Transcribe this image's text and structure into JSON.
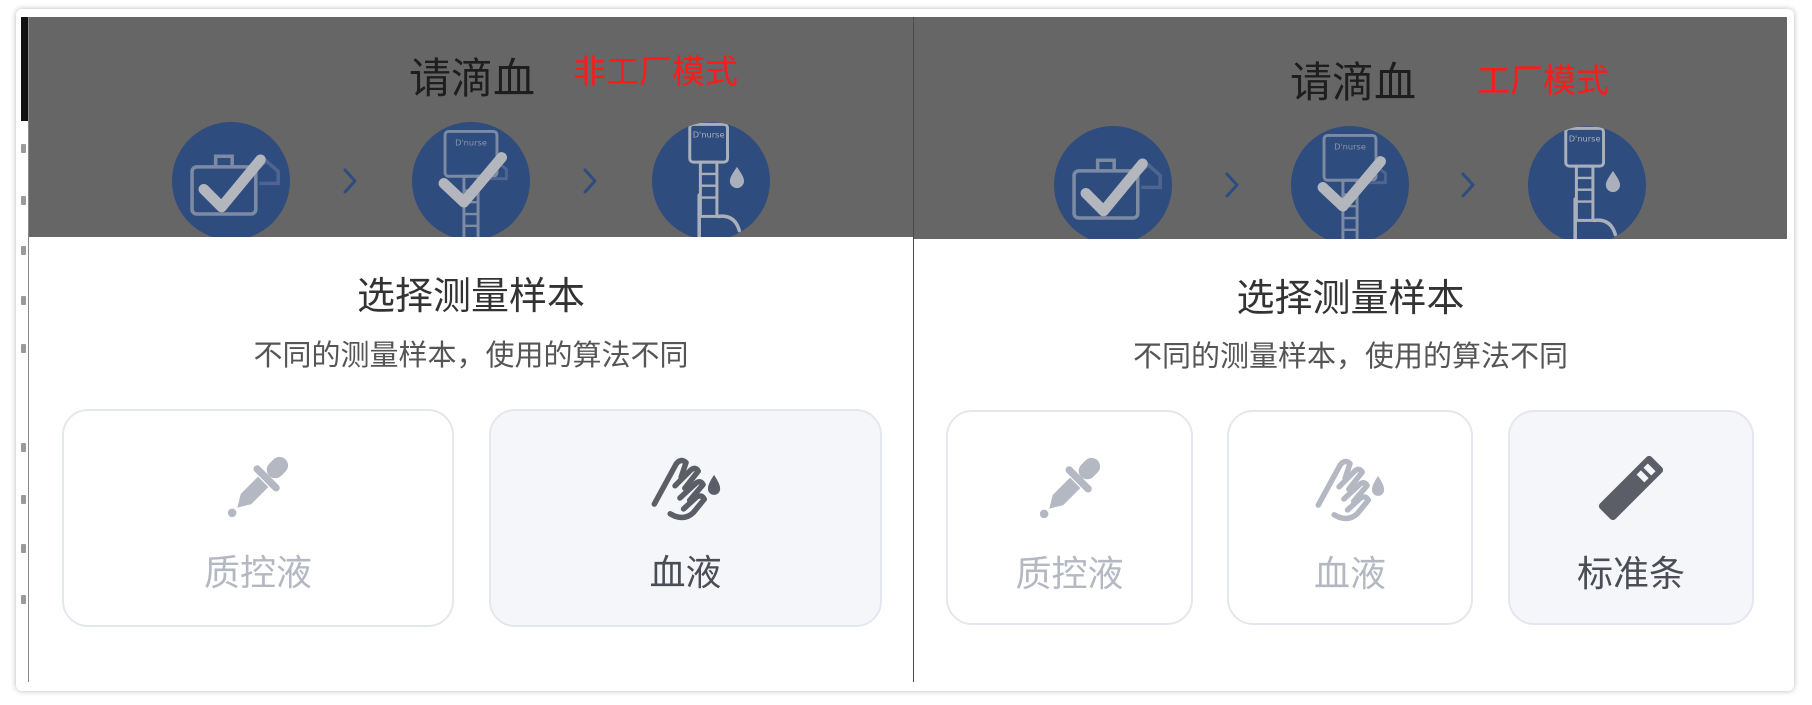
{
  "colors": {
    "header_dim": "#666666",
    "step_circle": "#2f4c7f",
    "mode_label": "#ff1a1a",
    "card_selected_bg": "#f5f6fa",
    "inactive": "#b4b8c3",
    "active": "#4a4d55"
  },
  "panels": [
    {
      "header": {
        "title": "请滴血",
        "mode_label": "非工厂模式",
        "device_logo": "D'nurse",
        "steps": [
          {
            "icon": "kit-check-icon"
          },
          {
            "icon": "device-check-icon"
          },
          {
            "icon": "finger-blood-icon"
          }
        ]
      },
      "sheet": {
        "title": "选择测量样本",
        "subtitle": "不同的测量样本，使用的算法不同",
        "options": [
          {
            "label": "质控液",
            "icon": "dropper-icon",
            "selected": false
          },
          {
            "label": "血液",
            "icon": "blood-hand-icon",
            "selected": true
          }
        ]
      }
    },
    {
      "header": {
        "title": "请滴血",
        "mode_label": "工厂模式",
        "device_logo": "D'nurse",
        "steps": [
          {
            "icon": "kit-check-icon"
          },
          {
            "icon": "device-check-icon"
          },
          {
            "icon": "finger-blood-icon"
          }
        ]
      },
      "sheet": {
        "title": "选择测量样本",
        "subtitle": "不同的测量样本，使用的算法不同",
        "options": [
          {
            "label": "质控液",
            "icon": "dropper-icon",
            "selected": false
          },
          {
            "label": "血液",
            "icon": "blood-hand-icon",
            "selected": false
          },
          {
            "label": "标准条",
            "icon": "test-strip-icon",
            "selected": true
          }
        ]
      }
    }
  ]
}
